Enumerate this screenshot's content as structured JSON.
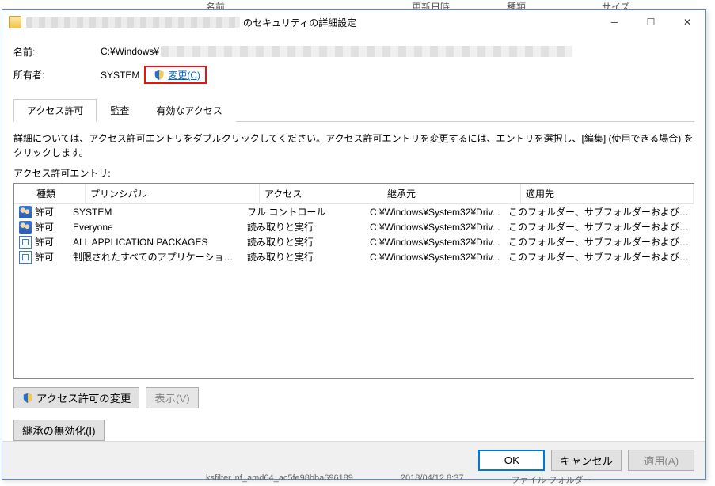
{
  "explorer_bg": {
    "col1": "名前",
    "col2": "更新日時",
    "col3": "種類",
    "col4": "サイズ"
  },
  "titlebar": {
    "title_suffix": "のセキュリティの詳細設定"
  },
  "fields": {
    "name_label": "名前:",
    "name_value_prefix": "C:¥Windows¥",
    "owner_label": "所有者:",
    "owner_value": "SYSTEM",
    "change_link": "変更(C)"
  },
  "tabs": {
    "permissions": "アクセス許可",
    "auditing": "監査",
    "effective": "有効なアクセス"
  },
  "instructions": "詳細については、アクセス許可エントリをダブルクリックしてください。アクセス許可エントリを変更するには、エントリを選択し、[編集] (使用できる場合) をクリックします。",
  "entries_label": "アクセス許可エントリ:",
  "columns": {
    "type": "種類",
    "principal": "プリンシパル",
    "access": "アクセス",
    "inherited": "継承元",
    "applies": "適用先"
  },
  "rows": [
    {
      "icon": "users",
      "type": "許可",
      "principal": "SYSTEM",
      "access": "フル コントロール",
      "inherited": "C:¥Windows¥System32¥Driv...",
      "applies": "このフォルダー、サブフォルダーおよびファイル"
    },
    {
      "icon": "users",
      "type": "許可",
      "principal": "Everyone",
      "access": "読み取りと実行",
      "inherited": "C:¥Windows¥System32¥Driv...",
      "applies": "このフォルダー、サブフォルダーおよびファイル"
    },
    {
      "icon": "pkg",
      "type": "許可",
      "principal": "ALL APPLICATION PACKAGES",
      "access": "読み取りと実行",
      "inherited": "C:¥Windows¥System32¥Driv...",
      "applies": "このフォルダー、サブフォルダーおよびファイル"
    },
    {
      "icon": "pkg",
      "type": "許可",
      "principal": "制限されたすべてのアプリケーション パッケ...",
      "access": "読み取りと実行",
      "inherited": "C:¥Windows¥System32¥Driv...",
      "applies": "このフォルダー、サブフォルダーおよびファイル"
    }
  ],
  "buttons": {
    "change_perms": "アクセス許可の変更",
    "view": "表示(V)",
    "disable_inherit": "継承の無効化(I)",
    "ok": "OK",
    "cancel": "キャンセル",
    "apply": "適用(A)"
  },
  "explorer_footer": {
    "filename": "ksfilter.inf_amd64_ac5fe98bba696189",
    "date": "2018/04/12 8:37",
    "type": "ファイル フォルダー"
  }
}
